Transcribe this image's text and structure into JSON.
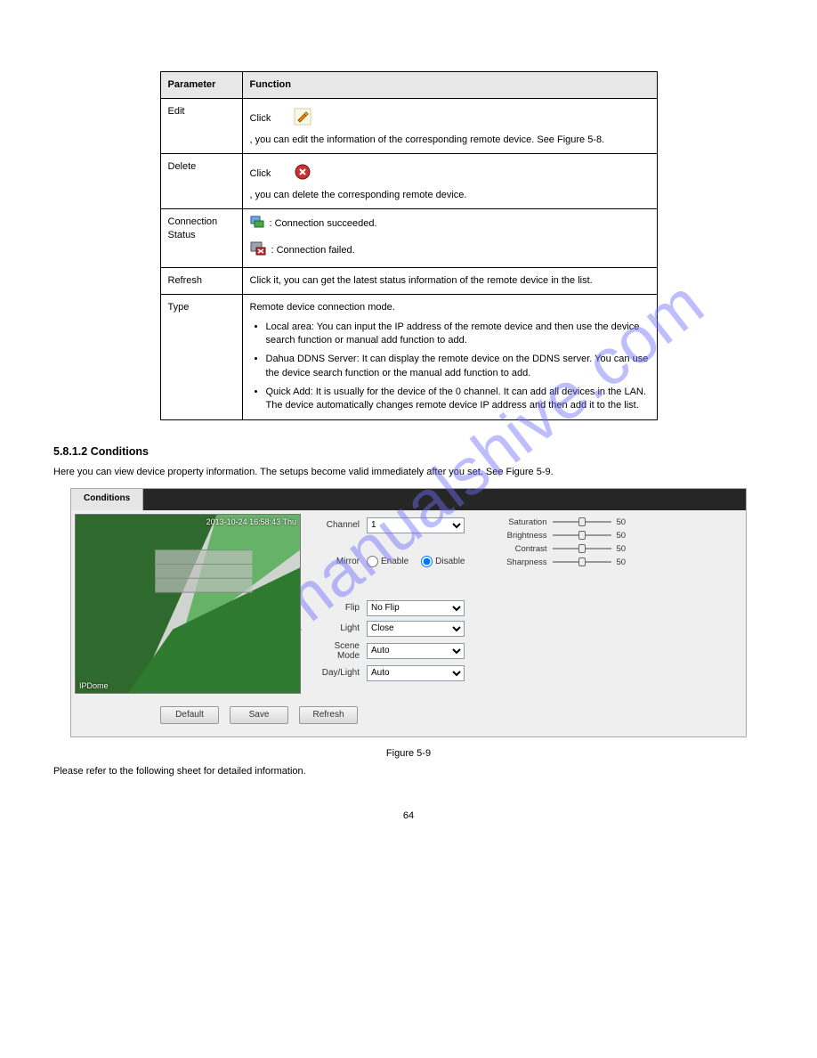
{
  "watermark": "manualshive.com",
  "table": {
    "header_param": "Parameter",
    "header_func": "Function",
    "rows": [
      {
        "param": "Edit",
        "func_prefix": "Click",
        "func_suffix": ", you can edit the information of the corresponding remote device. See Figure 5-8.",
        "icon": "edit"
      },
      {
        "param": "Delete",
        "func_prefix": "Click",
        "func_suffix": ", you can delete the corresponding remote device.",
        "icon": "delete"
      },
      {
        "param": "Connection Status",
        "lines": [
          " : Connection succeeded.",
          " : Connection failed."
        ],
        "icons": [
          "status-ok",
          "status-fail"
        ]
      },
      {
        "param": "Refresh",
        "func": "Click it, you can get the latest status information of the remote device in the list."
      },
      {
        "param": "Type",
        "intro": "Remote device connection mode.",
        "bullets": [
          "Local area: You can input the IP address of the remote device and then use the device search function or manual add function to add.",
          "Dahua DDNS Server: It can display the remote device on the DDNS server. You can use the device search function or the manual add function to add.",
          "Quick Add: It is usually for the device of the 0 channel. It can add all devices in the LAN. The device automatically changes remote device IP address and then add it to the list."
        ]
      }
    ]
  },
  "section_heading": "5.8.1.2 Conditions",
  "section_text": "Here you can view device property information. The setups become valid immediately after you set. See Figure 5-9.",
  "shot": {
    "tab": "Conditions",
    "osd_top": "2013-10-24 16:58:43 Thu",
    "osd_bottom": "IPDome",
    "channel_label": "Channel",
    "channel_value": "1",
    "mirror_label": "Mirror",
    "mirror_enable": "Enable",
    "mirror_disable": "Disable",
    "sliders": [
      {
        "label": "Saturation",
        "value": "50",
        "pos": 50
      },
      {
        "label": "Brightness",
        "value": "50",
        "pos": 50
      },
      {
        "label": "Contrast",
        "value": "50",
        "pos": 50
      },
      {
        "label": "Sharpness",
        "value": "50",
        "pos": 50
      }
    ],
    "dropdowns": [
      {
        "label": "Flip",
        "value": "No Flip"
      },
      {
        "label": "Light",
        "value": "Close"
      },
      {
        "label": "Scene Mode",
        "value": "Auto"
      },
      {
        "label": "Day/Light",
        "value": "Auto"
      }
    ],
    "buttons": {
      "default": "Default",
      "save": "Save",
      "refresh": "Refresh"
    }
  },
  "figure_caption": "Figure 5-9",
  "figure_note": "Please refer to the following sheet for detailed information.",
  "page_number": "64"
}
